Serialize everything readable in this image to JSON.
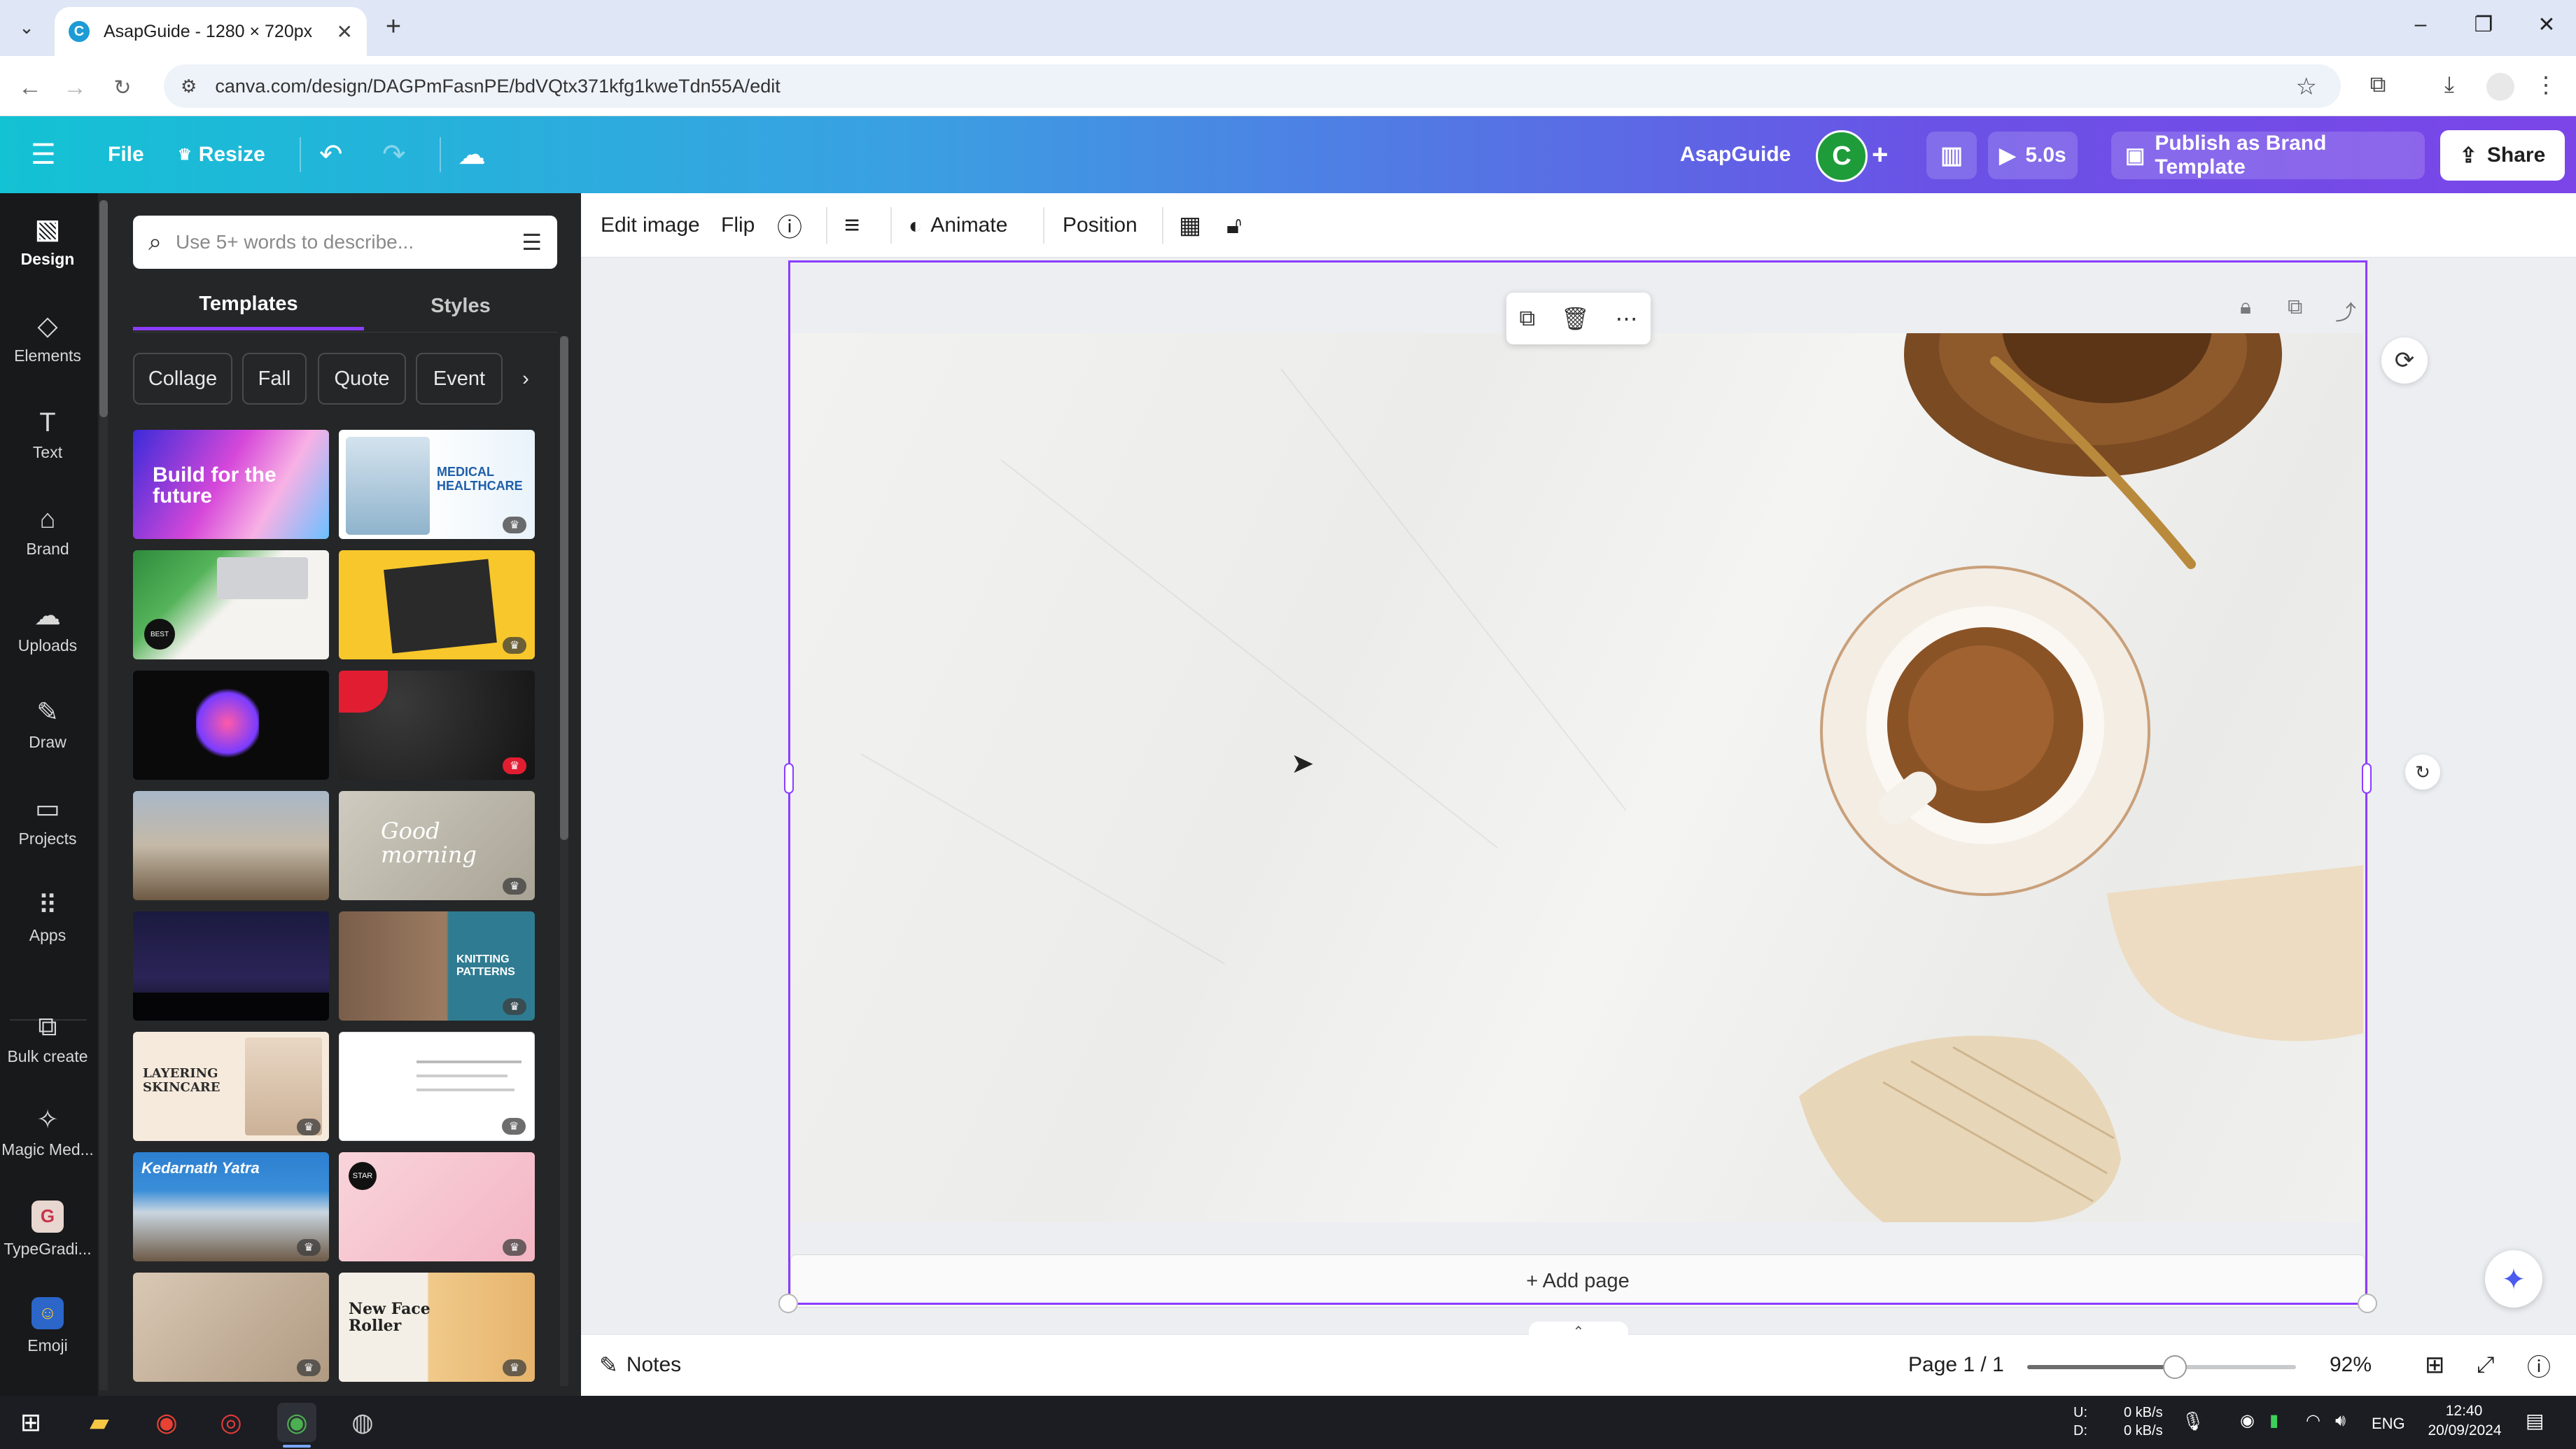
{
  "browser": {
    "tab_title": "AsapGuide - 1280 × 720px",
    "url": "canva.com/design/DAGPmFasnPE/bdVQtx371kfg1kweTdn55A/edit"
  },
  "header": {
    "menu": "File",
    "resize": "Resize",
    "team_name": "AsapGuide",
    "avatar_initial": "C",
    "play_duration": "5.0s",
    "publish_label": "Publish as Brand Template",
    "share_label": "Share"
  },
  "rail": {
    "items": [
      {
        "label": "Design",
        "icon": "design-icon"
      },
      {
        "label": "Elements",
        "icon": "elements-icon"
      },
      {
        "label": "Text",
        "icon": "text-icon"
      },
      {
        "label": "Brand",
        "icon": "brand-icon"
      },
      {
        "label": "Uploads",
        "icon": "uploads-icon"
      },
      {
        "label": "Draw",
        "icon": "draw-icon"
      },
      {
        "label": "Projects",
        "icon": "projects-icon"
      },
      {
        "label": "Apps",
        "icon": "apps-icon"
      },
      {
        "label": "Bulk create",
        "icon": "bulk-create-icon"
      },
      {
        "label": "Magic Med...",
        "icon": "magic-media-icon"
      },
      {
        "label": "TypeGradi...",
        "icon": "typegradient-icon"
      },
      {
        "label": "Emoji",
        "icon": "emoji-icon"
      }
    ]
  },
  "panel": {
    "search_placeholder": "Use 5+ words to describe...",
    "tabs": [
      "Templates",
      "Styles"
    ],
    "chips": [
      "Collage",
      "Fall",
      "Quote",
      "Event"
    ],
    "template_texts": {
      "t1": "Build for the future",
      "t2": "MEDICAL HEALTHCARE",
      "t3": "BEST",
      "t8": "Good morning",
      "t10": "KNITTING PATTERNS",
      "t11": "LAYERING SKINCARE",
      "t13": "Kedarnath Yatra",
      "t14": "STAR",
      "t16": "New Face Roller"
    }
  },
  "context_toolbar": {
    "edit_image": "Edit image",
    "flip": "Flip",
    "animate": "Animate",
    "position": "Position"
  },
  "canvas": {
    "add_page": "+ Add page"
  },
  "bottom_bar": {
    "notes": "Notes",
    "page_indicator": "Page 1 / 1",
    "zoom": "92%",
    "zoom_fraction": 0.55
  },
  "taskbar": {
    "net_up_label": "U:",
    "net_down_label": "D:",
    "net_up": "0 kB/s",
    "net_down": "0 kB/s",
    "lang": "ENG",
    "time": "12:40",
    "date": "20/09/2024"
  },
  "colors": {
    "accent": "#8b3dff",
    "header_gradient_start": "#13c2d4",
    "header_gradient_end": "#7b45e8",
    "rail_bg": "#18191b",
    "panel_bg": "#252627"
  }
}
